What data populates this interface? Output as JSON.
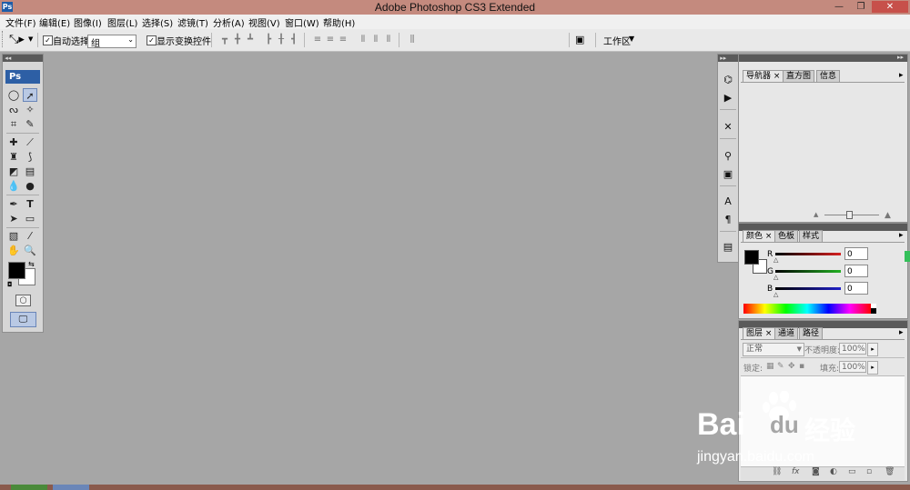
{
  "window": {
    "title": "Adobe Photoshop CS3 Extended",
    "logo": "Ps",
    "minimize": "—",
    "restore": "❐",
    "close": "✕"
  },
  "menu": [
    "文件(F)",
    "编辑(E)",
    "图像(I)",
    "图层(L)",
    "选择(S)",
    "滤镜(T)",
    "分析(A)",
    "视图(V)",
    "窗口(W)",
    "帮助(H)"
  ],
  "options": {
    "auto_select_label": "自动选择:",
    "auto_select_value": "组",
    "show_transform_label": "显示变换控件",
    "workspace_label": "工作区"
  },
  "toolbox": {
    "badge": "Ps"
  },
  "navigator_panel": {
    "tabs": [
      "导航器",
      "直方图",
      "信息"
    ]
  },
  "color_panel": {
    "tabs": [
      "颜色",
      "色板",
      "样式"
    ],
    "channels": [
      {
        "label": "R",
        "value": "0",
        "color": "#d62020"
      },
      {
        "label": "G",
        "value": "0",
        "color": "#22b022"
      },
      {
        "label": "B",
        "value": "0",
        "color": "#2020c8"
      }
    ]
  },
  "layers_panel": {
    "tabs": [
      "图层",
      "通道",
      "路径"
    ],
    "blend_mode": "正常",
    "opacity_label": "不透明度:",
    "opacity_value": "100%",
    "lock_label": "锁定:",
    "fill_label": "填充:",
    "fill_value": "100%"
  },
  "watermark": {
    "brand": "Bai",
    "brand2": "du",
    "brand_cn": "经验",
    "url": "jingyan.baidu.com"
  },
  "colors": {
    "titlebar": "#c48a7e",
    "canvas": "#a6a6a6",
    "panel": "#e7e7e7",
    "ps_blue": "#2d5fa5"
  }
}
